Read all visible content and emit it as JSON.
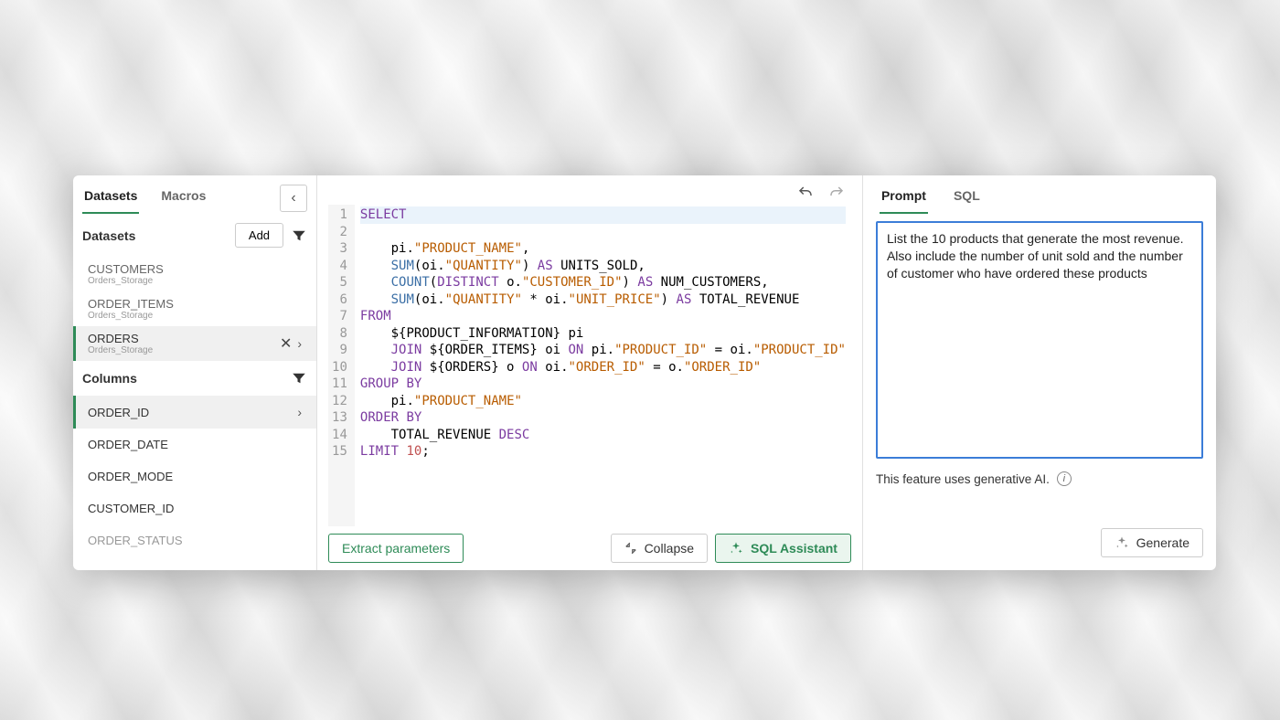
{
  "sidebar": {
    "tabs": {
      "datasets": "Datasets",
      "macros": "Macros"
    },
    "activeTab": "Datasets",
    "sectionDatasets": "Datasets",
    "addLabel": "Add",
    "items": [
      {
        "name": "CUSTOMERS",
        "sub": "Orders_Storage"
      },
      {
        "name": "ORDER_ITEMS",
        "sub": "Orders_Storage"
      },
      {
        "name": "ORDERS",
        "sub": "Orders_Storage"
      }
    ],
    "selectedIndex": 2,
    "sectionColumns": "Columns",
    "columns": [
      "ORDER_ID",
      "ORDER_DATE",
      "ORDER_MODE",
      "CUSTOMER_ID",
      "ORDER_STATUS"
    ],
    "selectedColumnIndex": 0
  },
  "editor": {
    "lineCount": 15,
    "code": {
      "l1": "SELECT",
      "l2_a": "    pi.",
      "l2_str": "\"PRODUCT_NAME\"",
      "l2_b": ",",
      "l3_a": "    ",
      "l3_fn": "SUM",
      "l3_b": "(oi.",
      "l3_str": "\"QUANTITY\"",
      "l3_c": ") ",
      "l3_kw": "AS",
      "l3_d": " UNITS_SOLD,",
      "l4_a": "    ",
      "l4_fn": "COUNT",
      "l4_b": "(",
      "l4_kw1": "DISTINCT",
      "l4_c": " o.",
      "l4_str": "\"CUSTOMER_ID\"",
      "l4_d": ") ",
      "l4_kw2": "AS",
      "l4_e": " NUM_CUSTOMERS,",
      "l5_a": "    ",
      "l5_fn": "SUM",
      "l5_b": "(oi.",
      "l5_str1": "\"QUANTITY\"",
      "l5_c": " * oi.",
      "l5_str2": "\"UNIT_PRICE\"",
      "l5_d": ") ",
      "l5_kw": "AS",
      "l5_e": " TOTAL_REVENUE",
      "l6": "FROM",
      "l7": "    ${PRODUCT_INFORMATION} pi",
      "l8_a": "    ",
      "l8_kw1": "JOIN",
      "l8_b": " ${ORDER_ITEMS} oi ",
      "l8_kw2": "ON",
      "l8_c": " pi.",
      "l8_str1": "\"PRODUCT_ID\"",
      "l8_d": " = oi.",
      "l8_str2": "\"PRODUCT_ID\"",
      "l9_a": "    ",
      "l9_kw1": "JOIN",
      "l9_b": " ${ORDERS} o ",
      "l9_kw2": "ON",
      "l9_c": " oi.",
      "l9_str1": "\"ORDER_ID\"",
      "l9_d": " = o.",
      "l9_str2": "\"ORDER_ID\"",
      "l10": "GROUP BY",
      "l11_a": "    pi.",
      "l11_str": "\"PRODUCT_NAME\"",
      "l12": "ORDER BY",
      "l13_a": "    TOTAL_REVENUE ",
      "l13_kw": "DESC",
      "l14_a": "LIMIT",
      "l14_b": " ",
      "l14_num": "10",
      "l14_c": ";"
    },
    "buttons": {
      "extract": "Extract parameters",
      "collapse": "Collapse",
      "assistant": "SQL Assistant"
    }
  },
  "assistant": {
    "tabs": {
      "prompt": "Prompt",
      "sql": "SQL"
    },
    "activeTab": "Prompt",
    "promptText": "List the 10 products that generate the most revenue.\nAlso include the number of unit sold and the number of customer who have ordered these products",
    "aiNote": "This feature uses generative AI.",
    "generate": "Generate"
  }
}
